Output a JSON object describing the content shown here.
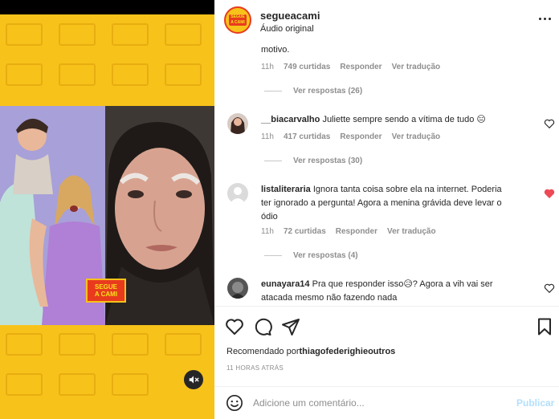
{
  "post": {
    "username": "segueacami",
    "audio": "Áudio original",
    "more_icon": "more-horizontal-icon"
  },
  "media": {
    "badge_line1": "SEGUE",
    "badge_line2": "A CAMI",
    "mute_icon": "speaker-muted-icon",
    "brand_yellow": "#f7c21a",
    "brand_red": "#e83b1e"
  },
  "comments": [
    {
      "text": "motivo.",
      "time": "11h",
      "likes": "749 curtidas",
      "reply": "Responder",
      "translate": "Ver tradução",
      "replies": "Ver respostas (26)"
    },
    {
      "user": "__biacarvalho",
      "text": "Juliette sempre sendo a vítima de tudo 😑",
      "time": "11h",
      "likes": "417 curtidas",
      "reply": "Responder",
      "translate": "Ver tradução",
      "replies": "Ver respostas (30)",
      "liked": false
    },
    {
      "user": "listaliteraria",
      "text_line1": "Ignora tanta coisa sobre ela na internet. Poderia",
      "text_line2": "ter ignorado a pergunta! Agora a menina grávida deve levar o",
      "text_line3": "ódio",
      "time": "11h",
      "likes": "72 curtidas",
      "reply": "Responder",
      "translate": "Ver tradução",
      "replies": "Ver respostas (4)",
      "liked": true
    },
    {
      "user": "eunayara14",
      "text_line1": "Pra que responder isso😥? Agora a vih vai ser",
      "text_line2": "atacada mesmo não fazendo nada",
      "liked": false
    }
  ],
  "actions": {
    "like_icon": "heart-icon",
    "comment_icon": "comment-icon",
    "share_icon": "share-icon",
    "save_icon": "bookmark-icon",
    "recommended_prefix": "Recomendado por",
    "recommended_by": "thiagofederighieoutros",
    "time": "11 HORAS ATRÁS"
  },
  "add_comment": {
    "emoji_icon": "emoji-icon",
    "placeholder": "Adicione um comentário...",
    "publish": "Publicar"
  },
  "colors": {
    "liked_heart": "#ed4956",
    "publish_disabled": "#b2dffc"
  }
}
